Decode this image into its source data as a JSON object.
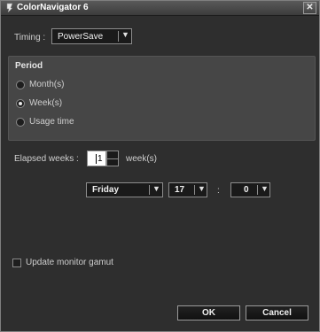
{
  "window": {
    "title": "ColorNavigator 6",
    "close_glyph": "✕"
  },
  "timing": {
    "label": "Timing :",
    "value": "PowerSave"
  },
  "period": {
    "title": "Period",
    "options": [
      {
        "label": "Month(s)",
        "selected": false
      },
      {
        "label": "Week(s)",
        "selected": true
      },
      {
        "label": "Usage time",
        "selected": false
      }
    ]
  },
  "elapsed": {
    "label": "Elapsed weeks :",
    "value": "1",
    "unit": "week(s)"
  },
  "schedule": {
    "day": "Friday",
    "hour": "17",
    "separator": ":",
    "minute": "0"
  },
  "gamut": {
    "label": "Update monitor gamut",
    "checked": false
  },
  "buttons": {
    "ok": "OK",
    "cancel": "Cancel"
  },
  "icons": {
    "dropdown_arrow": "chevron-down-icon",
    "app": "colornavigator-app-icon"
  },
  "colors": {
    "background": "#2e2e2e",
    "panel": "#464646",
    "field": "#1a1a1a",
    "text": "#d4d4d4"
  }
}
